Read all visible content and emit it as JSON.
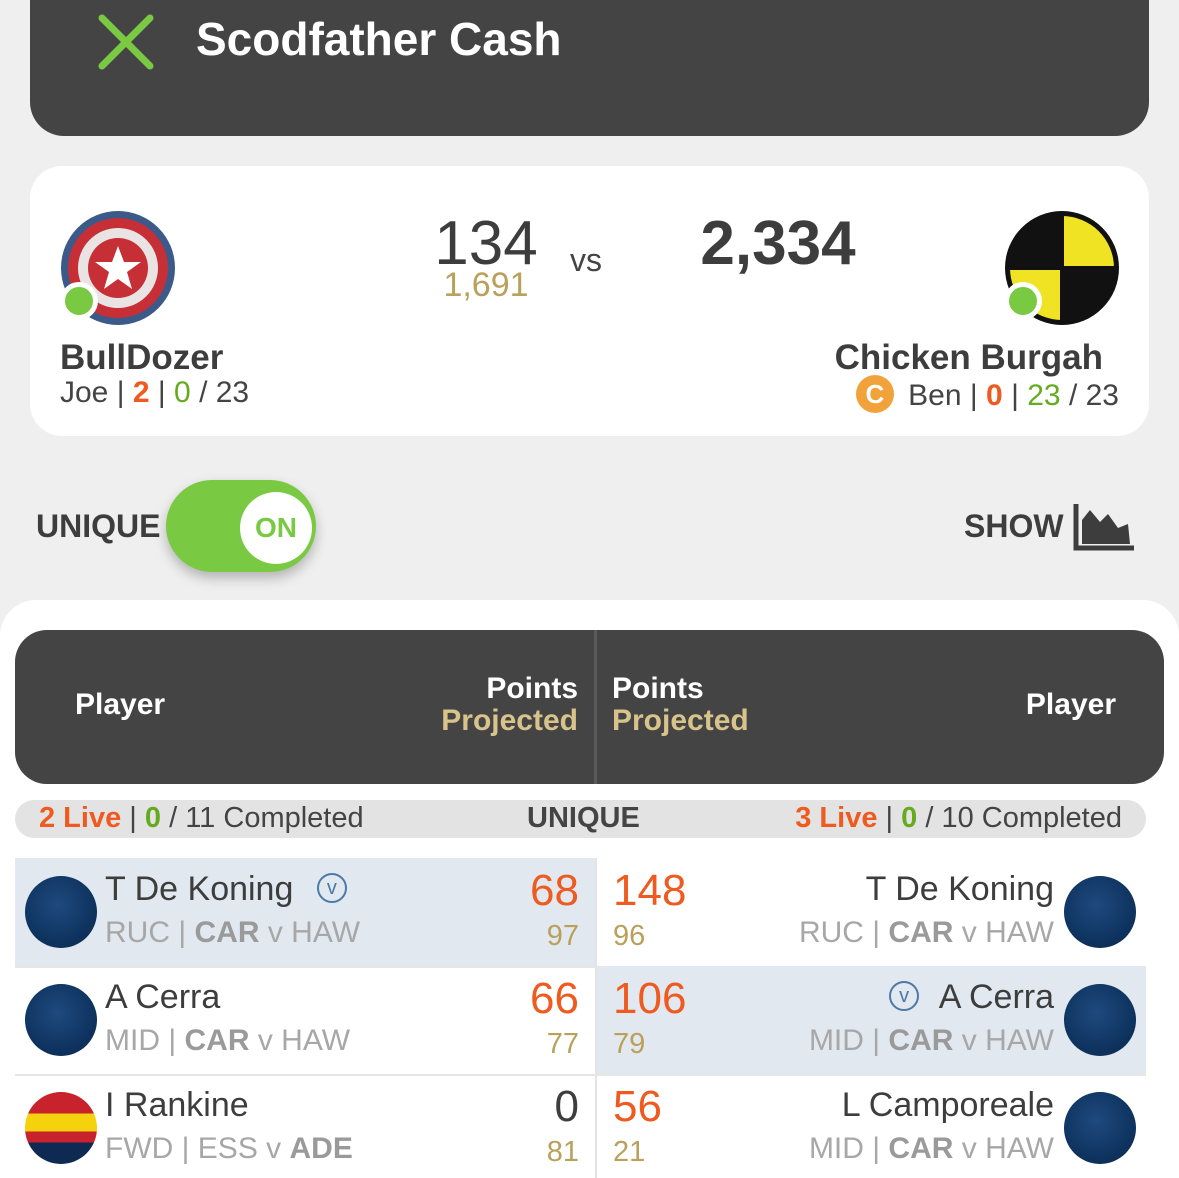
{
  "header": {
    "title": "Scodfather Cash",
    "close_icon": "close-x-icon",
    "accent": "#7ac943"
  },
  "match": {
    "left": {
      "team": "BullDozer",
      "owner": "Joe",
      "live": "2",
      "completed": "0",
      "total": "23",
      "score": "134",
      "projected": "1,691",
      "avatar": "shield-star-icon"
    },
    "vs": "vs",
    "right": {
      "team": "Chicken Burgah",
      "captain_badge": "C",
      "owner": "Ben",
      "live": "0",
      "completed": "23",
      "total": "23",
      "score": "2,334",
      "avatar": "crash-test-dummy-icon"
    }
  },
  "controls": {
    "unique_label": "UNIQUE",
    "toggle_state": "ON",
    "show_label": "SHOW",
    "show_icon": "area-chart-icon"
  },
  "table_header": {
    "player_left": "Player",
    "points_left": "Points",
    "projected_left": "Projected",
    "points_right": "Points",
    "projected_right": "Projected",
    "player_right": "Player"
  },
  "summary": {
    "left_live": "2 Live",
    "left_completed": "0",
    "left_total": "/ 11 Completed",
    "center": "UNIQUE",
    "right_live": "3 Live",
    "right_completed": "0",
    "right_total": "/ 10 Completed"
  },
  "sep": "|",
  "vc_badge": "v",
  "vs_word": "v",
  "rows": [
    {
      "left": {
        "name": "T De Koning",
        "vice": true,
        "pos": "RUC",
        "team": "CAR",
        "opp": "HAW",
        "points": "68",
        "projected": "97"
      },
      "right": {
        "name": "T De Koning",
        "vice": false,
        "pos": "RUC",
        "team": "CAR",
        "opp": "HAW",
        "points": "148",
        "projected": "96"
      }
    },
    {
      "left": {
        "name": "A Cerra",
        "vice": false,
        "pos": "MID",
        "team": "CAR",
        "opp": "HAW",
        "points": "66",
        "projected": "77"
      },
      "right": {
        "name": "A Cerra",
        "vice": true,
        "pos": "MID",
        "team": "CAR",
        "opp": "HAW",
        "points": "106",
        "projected": "79"
      }
    },
    {
      "left": {
        "name": "I Rankine",
        "vice": false,
        "pos": "FWD",
        "team": "ESS",
        "opp": "ADE",
        "points": "0",
        "projected": "81"
      },
      "right": {
        "name": "L Camporeale",
        "vice": false,
        "pos": "MID",
        "team": "CAR",
        "opp": "HAW",
        "points": "56",
        "projected": "21"
      }
    }
  ]
}
